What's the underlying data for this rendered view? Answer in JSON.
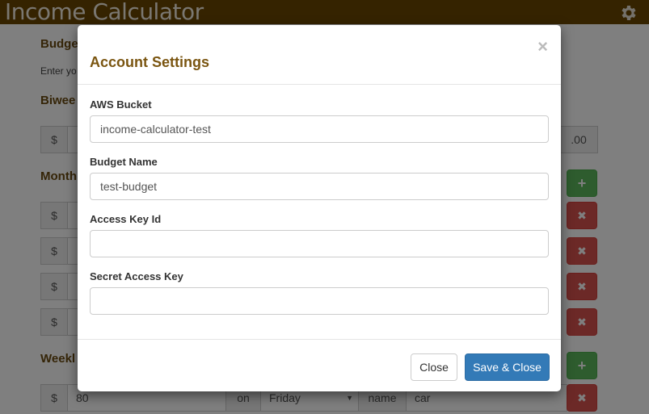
{
  "app": {
    "title": "Income Calculator"
  },
  "page": {
    "budget_heading": "Budge",
    "budget_sub": "Enter yo",
    "biweekly_heading": "Biwee",
    "monthly_heading": "Month",
    "weekly_heading": "Weekl",
    "currency_symbol": "$",
    "biweekly_cents": ".00",
    "add_glyph": "+",
    "remove_glyph": "✖",
    "weekly_row": {
      "amount": "80",
      "on_label": "on",
      "day": "Friday",
      "name_label": "name",
      "name_value": "car"
    }
  },
  "modal": {
    "title": "Account Settings",
    "close_glyph": "×",
    "fields": [
      {
        "label": "AWS Bucket",
        "value": "income-calculator-test",
        "placeholder": ""
      },
      {
        "label": "Budget Name",
        "value": "test-budget",
        "placeholder": ""
      },
      {
        "label": "Access Key Id",
        "value": "",
        "placeholder": ""
      },
      {
        "label": "Secret Access Key",
        "value": "",
        "placeholder": ""
      }
    ],
    "footer": {
      "close_label": "Close",
      "save_label": "Save & Close"
    }
  },
  "colors": {
    "topbar": "#6b4700",
    "heading": "#6b4a10",
    "primary": "#337ab7",
    "success": "#5cb85c",
    "danger": "#d9534f"
  }
}
